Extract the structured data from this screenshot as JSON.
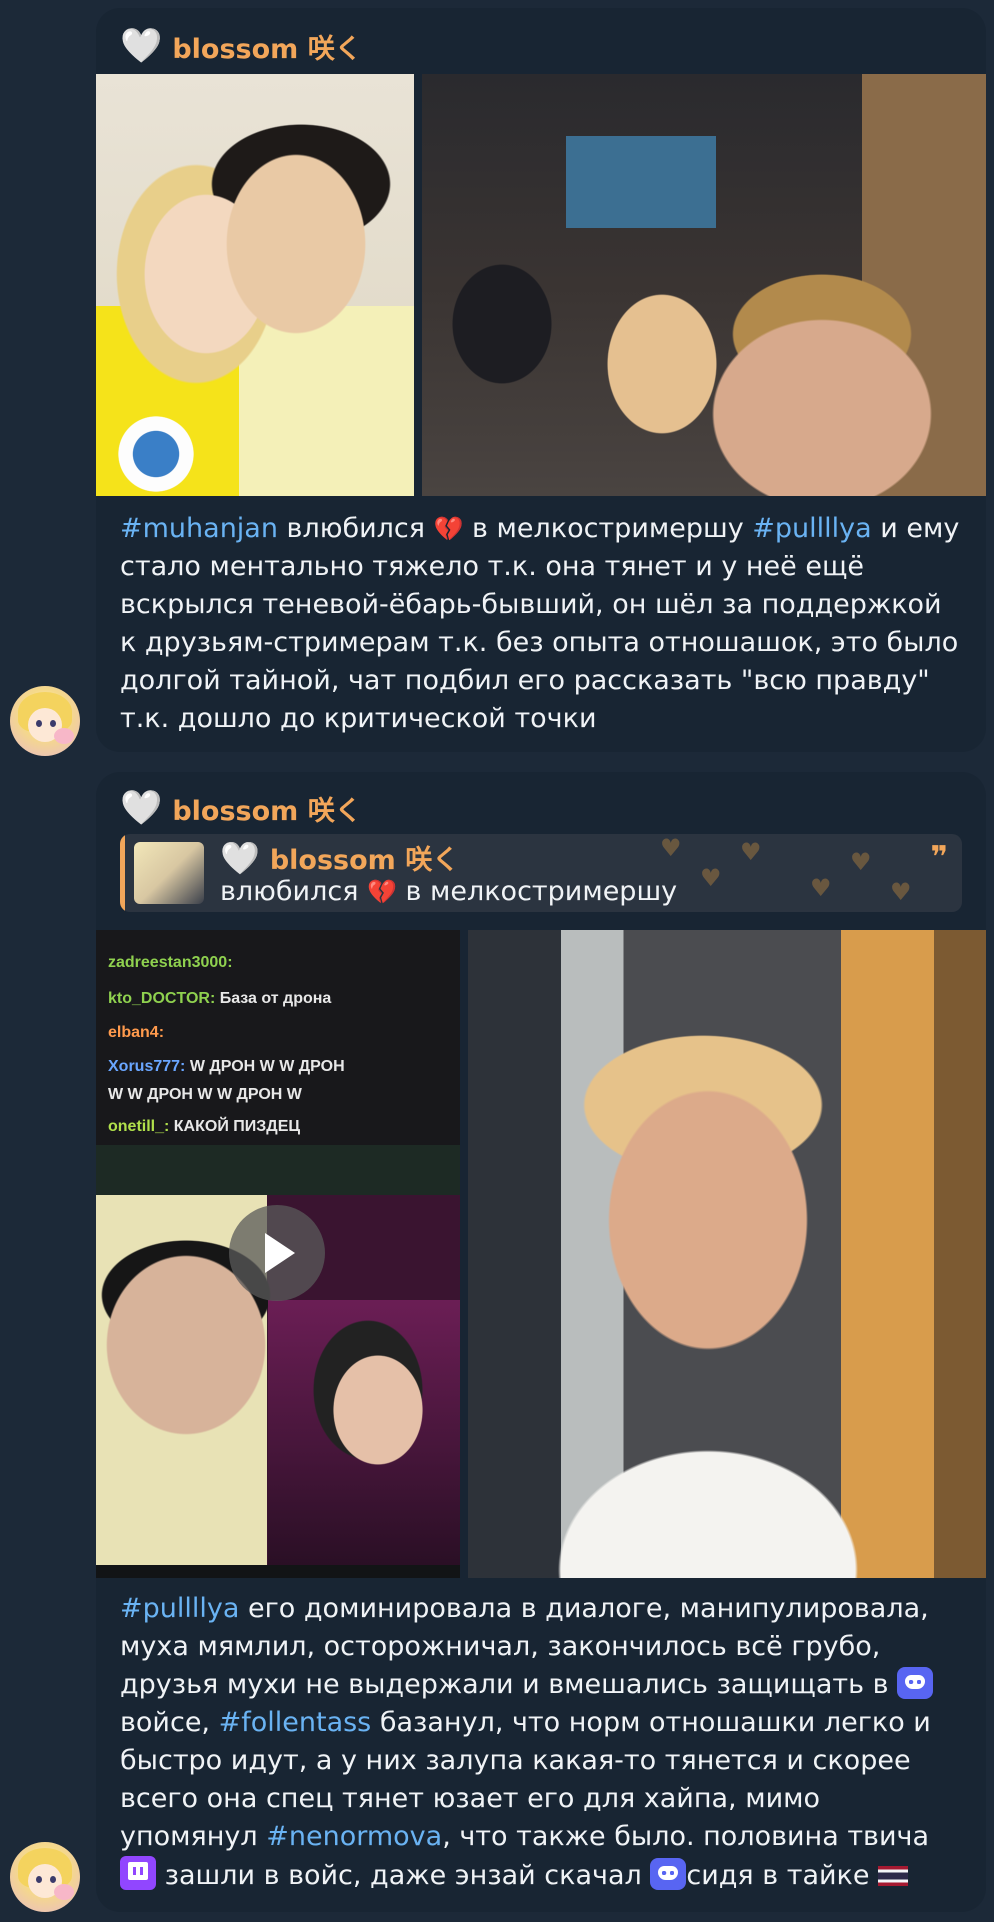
{
  "messages": [
    {
      "sender": "blossom 咲く",
      "heart": "🤍",
      "text": {
        "t1": "#muhanjan",
        "t2": " влюбился ",
        "e1": "💔",
        "t3": " в мелкостримершу ",
        "t4": "#pullllya",
        "t5": " и ему стало ментально тяжело т.к. она тянет и у неё ещё вскрылся теневой-ёбарь-бывший, он шёл за поддержкой к друзьям-стримерам т.к. без опыта отношашок, это было долгой тайной, чат подбил его рассказать \"всю правду\" т.к. дошло до критической точки"
      }
    },
    {
      "sender": "blossom 咲く",
      "heart": "🤍",
      "reply": {
        "sender": "blossom 咲く",
        "heart": "🤍",
        "text_a": "влюбился ",
        "emoji": "💔",
        "text_b": " в мелкостримершу",
        "quote_icon": "❞"
      },
      "chat_lines": [
        {
          "user": "zadreestan3000:",
          "text": ""
        },
        {
          "user": "kto_DOCTOR:",
          "text": " База от дрона"
        },
        {
          "user": "elban4:",
          "text": ""
        },
        {
          "user": "Xorus777:",
          "text": " W ДРОН W W ДРОН"
        },
        {
          "user": "",
          "text": "W W ДРОН W W ДРОН W"
        },
        {
          "user": "onetill_:",
          "text": " КАКОЙ ПИЗДЕЦ"
        }
      ],
      "text": {
        "t1": "#pullllya",
        "t2": " его доминировала в диалоге, манипулировала, муха мямлил, осторожничал, закончилось всё грубо, друзья мухи не выдержали и вмешались защищать в ",
        "t3": " войсе, ",
        "t4": "#follentass",
        "t5": " базанул, что норм отношашки легко и быстро идут, а у них залупа какая-то тянется и скорее всего она спец тянет юзает его для хайпа, мимо упомянул ",
        "t6": "#nenormova",
        "t7": ", что также было. половина твича ",
        "t8": " зашли в войс, даже энзай скачал ",
        "t9": "сидя в тайке "
      }
    }
  ],
  "colors": {
    "background": "#1c2938",
    "bubble": "#182533",
    "sender_name": "#f2a65a",
    "hashtag": "#6ab3f3",
    "text": "#f0f3f6"
  },
  "icons": [
    "white-heart-icon",
    "broken-heart-emoji",
    "discord-icon",
    "twitch-icon",
    "thailand-flag-emoji",
    "play-icon",
    "quote-icon"
  ]
}
